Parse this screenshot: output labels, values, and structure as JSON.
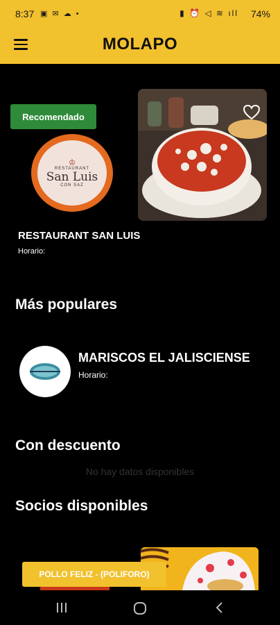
{
  "status_bar": {
    "time": "8:37",
    "left_icons": "▣ ✉ ☁ •",
    "right_icons": "▮ ⏰ ◁ ≋ ıll",
    "battery": "74%"
  },
  "app_bar": {
    "title": "MOLAPO",
    "menu_icon": "hamburger-icon"
  },
  "featured": {
    "badge": "Recomendado",
    "logo": {
      "top_text": "RESTAURANT",
      "name": "San Luis",
      "bottom_text": "CON SAZ"
    },
    "name": "RESTAURANT SAN LUIS",
    "hours_label": "Horario:",
    "favorite_icon": "heart-outline-icon"
  },
  "popular": {
    "heading": "Más populares",
    "items": [
      {
        "name": "MARISCOS EL JALISCIENSE",
        "hours_label": "Horario:"
      }
    ]
  },
  "discount": {
    "heading": "Con descuento",
    "empty_text": "No hay datos disponibles"
  },
  "partners": {
    "heading": "Socios disponibles",
    "items": [
      {
        "label": "POLLO FELIZ - (POLIFORO)"
      }
    ]
  },
  "nav_bar": {
    "icons": [
      "recents-icon",
      "home-icon",
      "back-icon"
    ]
  },
  "colors": {
    "brand_yellow": "#f2c12e",
    "recommended_green": "#2f8b3a",
    "logo_orange": "#e36a1f"
  }
}
